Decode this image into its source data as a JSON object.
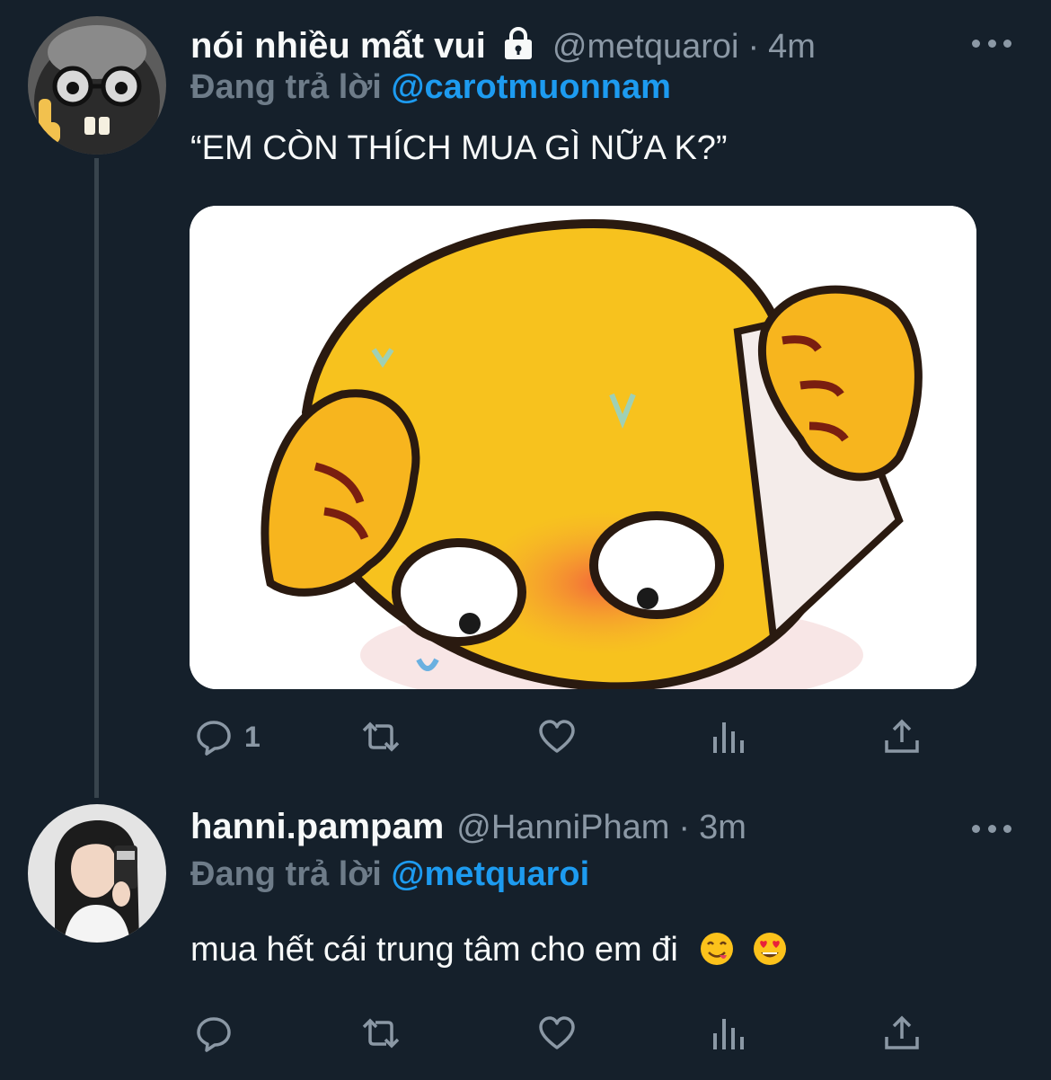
{
  "tweets": [
    {
      "display_name": "nói nhiều mất vui",
      "protected_icon": "lock-icon",
      "handle": "@metquaroi",
      "separator": "·",
      "time": "4m",
      "replying_prefix": "Đang trả lời",
      "replying_to": "@carotmuonnam",
      "text": "“EM CÒN THÍCH MUA GÌ NỮA K?”",
      "media": "meme-image",
      "reply_count": "1"
    },
    {
      "display_name": "hanni.pampam",
      "handle": "@HanniPham",
      "separator": "·",
      "time": "3m",
      "replying_prefix": "Đang trả lời",
      "replying_to": "@metquaroi",
      "text": "mua hết cái trung tâm cho em đi",
      "emojis": [
        "yum-emoji",
        "heart-eyes-emoji"
      ]
    }
  ],
  "action_icons": [
    "reply-icon",
    "retweet-icon",
    "like-icon",
    "analytics-icon",
    "share-icon"
  ],
  "colors": {
    "background": "#15202b",
    "secondary_text": "#8b98a5",
    "mention": "#1d9bf0",
    "thread_line": "#38444d"
  }
}
